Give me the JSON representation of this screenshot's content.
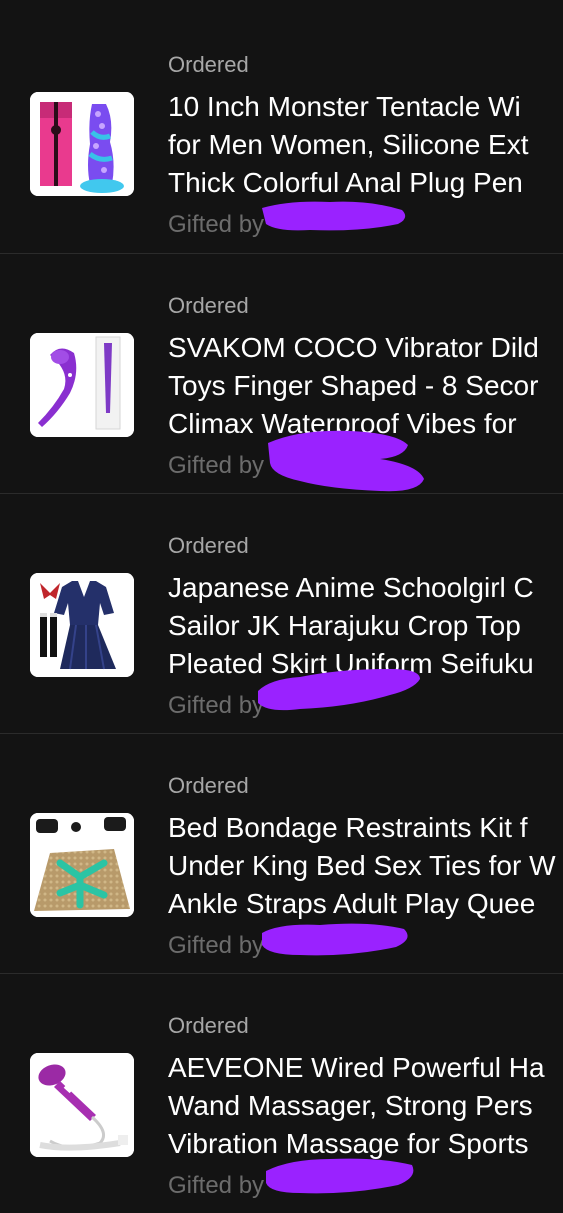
{
  "colors": {
    "background": "#131313",
    "divider": "#2b2b2b",
    "status_text": "#a7a7a7",
    "title_text": "#ffffff",
    "gifted_text": "#6c6c6c",
    "redaction": "#9a22ff"
  },
  "orders": [
    {
      "status": "Ordered",
      "title_lines": [
        "10 Inch Monster Tentacle Wi",
        "for Men Women, Silicone Ext",
        "Thick Colorful Anal Plug Pen"
      ],
      "gifted_label": "Gifted by",
      "thumbnail_icon": "tentacle-toy-product-image"
    },
    {
      "status": "Ordered",
      "title_lines": [
        "SVAKOM COCO Vibrator Dild",
        "Toys Finger Shaped - 8 Secor",
        "Climax Waterproof Vibes for"
      ],
      "gifted_label": "Gifted by",
      "thumbnail_icon": "vibrator-product-image"
    },
    {
      "status": "Ordered",
      "title_lines": [
        "Japanese Anime Schoolgirl C",
        "Sailor JK Harajuku Crop Top",
        "Pleated Skirt Uniform Seifuku"
      ],
      "gifted_label": "Gifted by",
      "thumbnail_icon": "sailor-uniform-product-image"
    },
    {
      "status": "Ordered",
      "title_lines": [
        "Bed Bondage Restraints Kit f",
        "Under King Bed Sex Ties for W",
        "Ankle Straps Adult Play Quee"
      ],
      "gifted_label": "Gifted by",
      "thumbnail_icon": "bed-restraints-product-image"
    },
    {
      "status": "Ordered",
      "title_lines": [
        "AEVEONE Wired Powerful Ha",
        "Wand Massager, Strong Pers",
        "Vibration Massage for Sports"
      ],
      "gifted_label": "Gifted by",
      "thumbnail_icon": "wand-massager-product-image"
    }
  ]
}
